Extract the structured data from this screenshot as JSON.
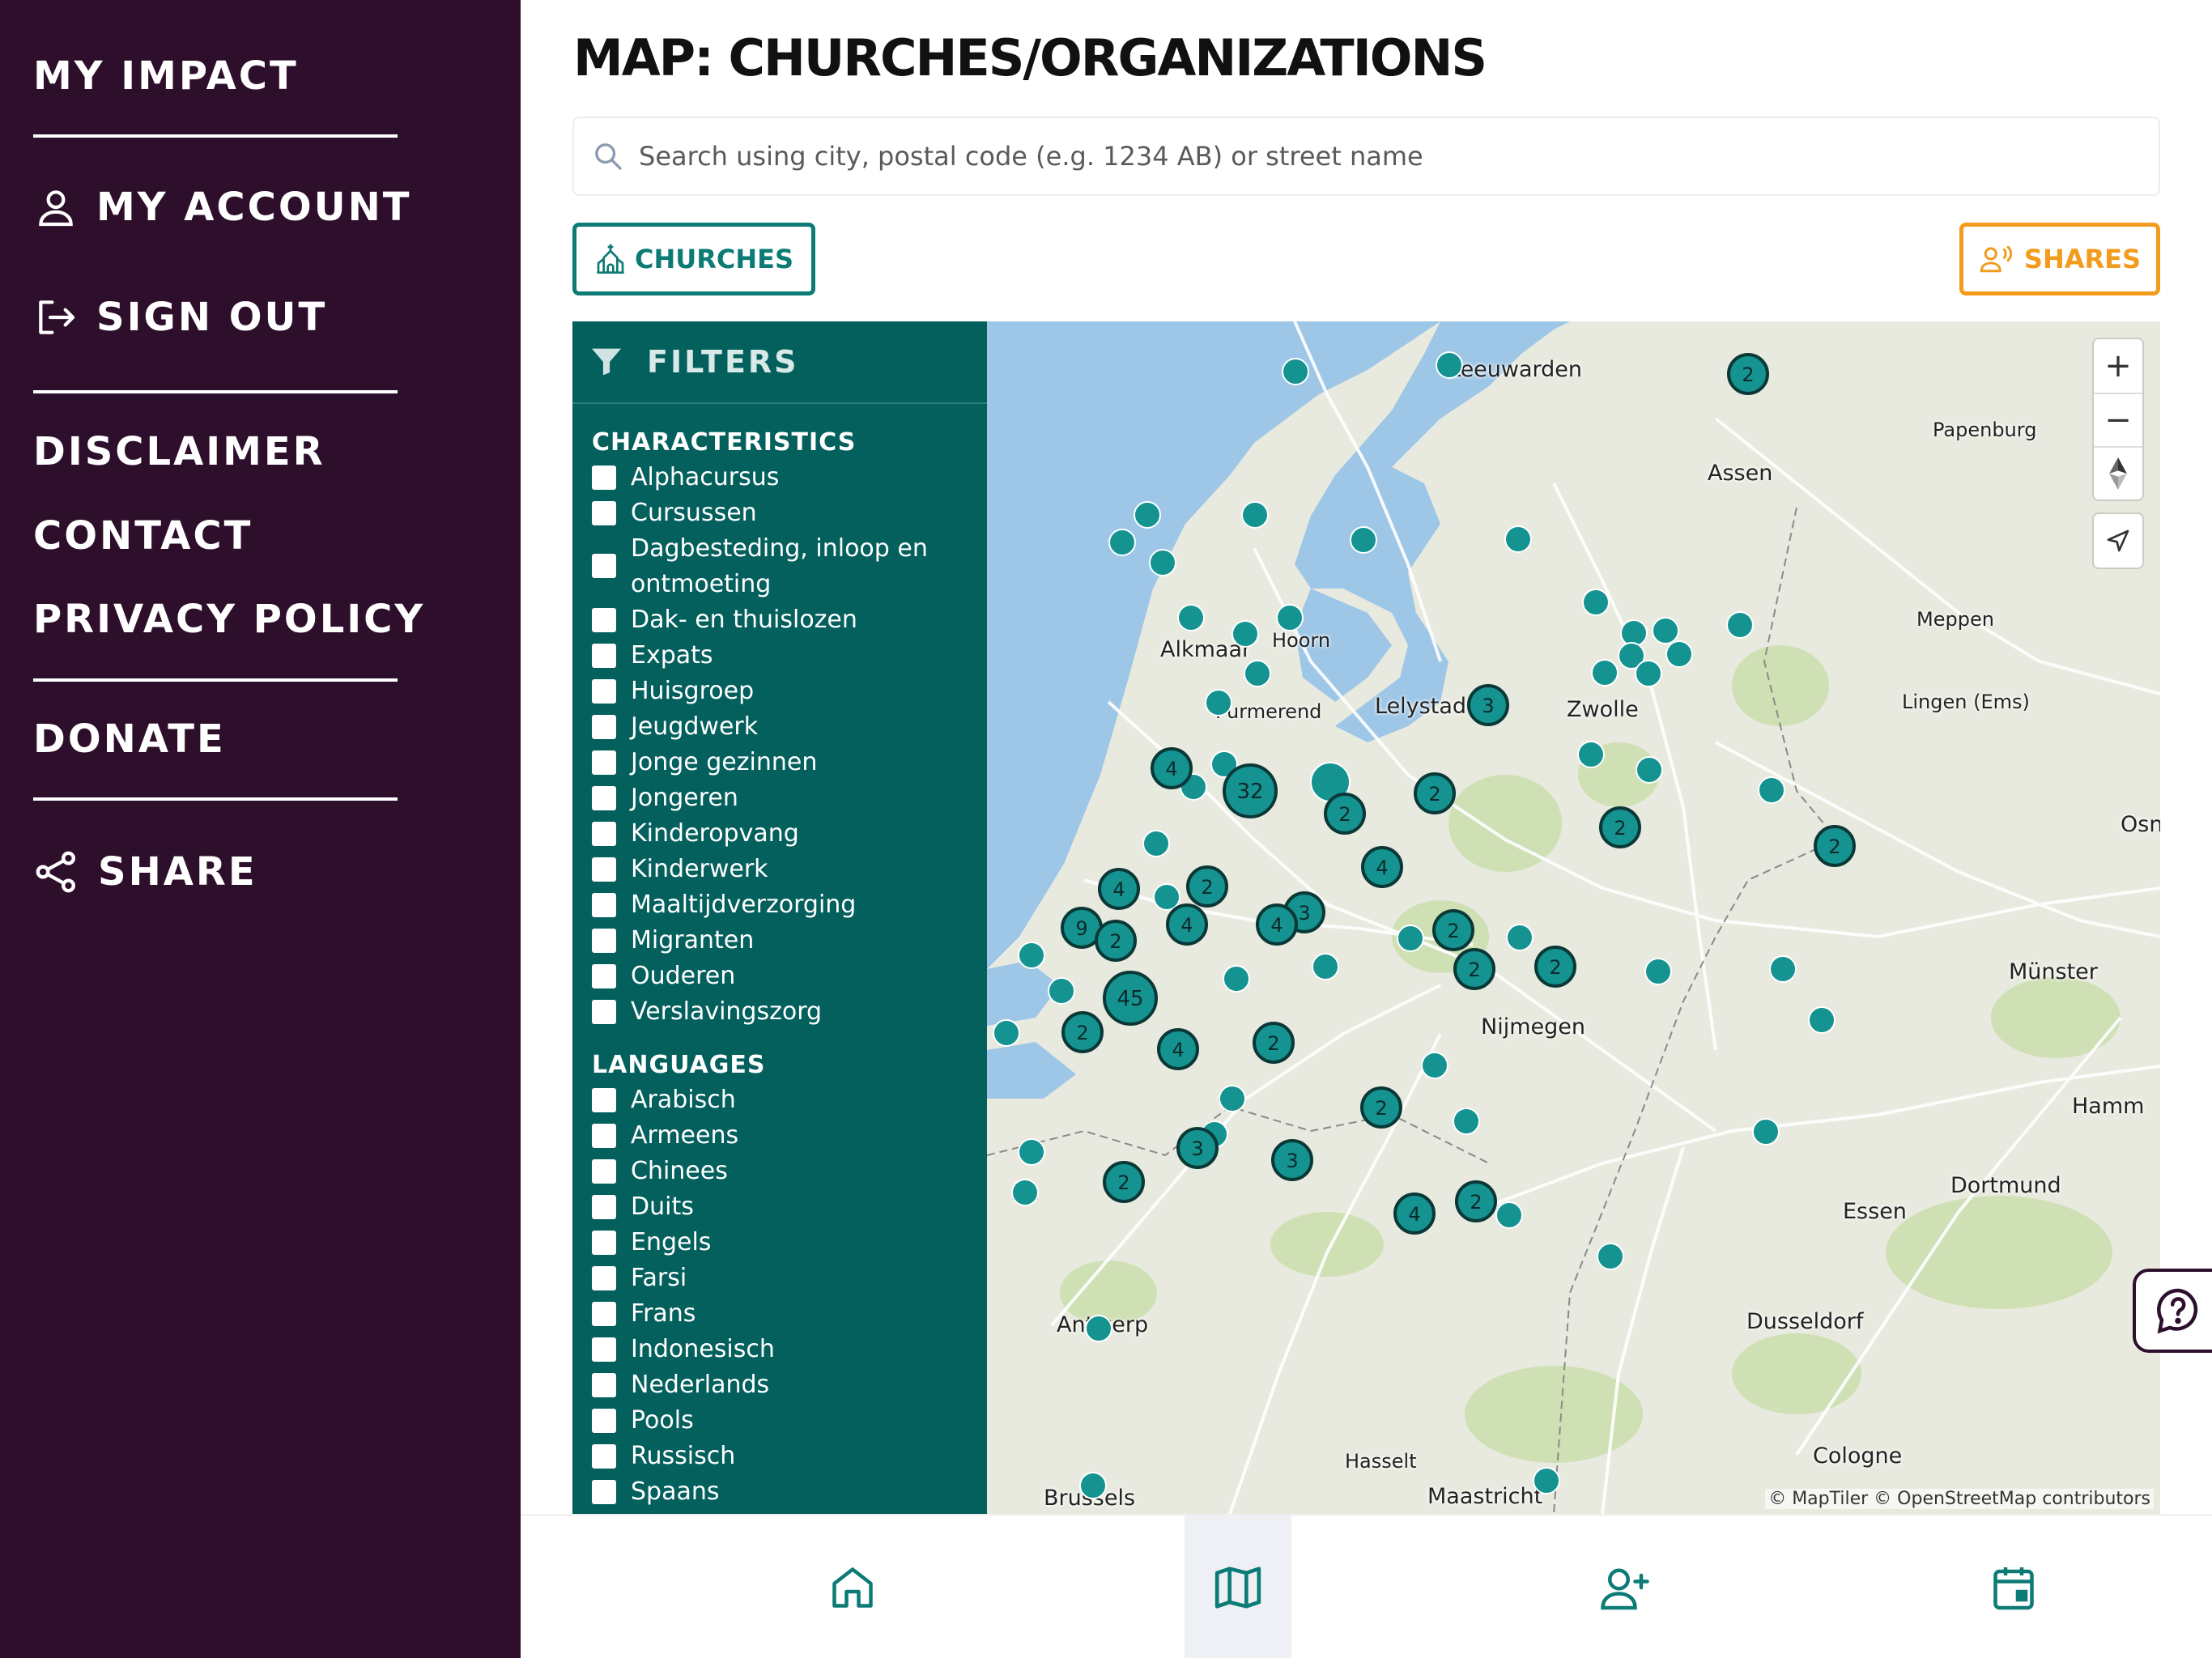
{
  "sidebar": {
    "my_impact": "MY IMPACT",
    "my_account": "MY ACCOUNT",
    "sign_out": "SIGN OUT",
    "disclaimer": "DISCLAIMER",
    "contact": "CONTACT",
    "privacy_policy": "PRIVACY POLICY",
    "donate": "DONATE",
    "share": "SHARE"
  },
  "header": {
    "title": "MAP: CHURCHES/ORGANIZATIONS"
  },
  "search": {
    "placeholder": "Search using city, postal code (e.g. 1234 AB) or street name",
    "value": ""
  },
  "buttons": {
    "churches": "CHURCHES",
    "shares": "SHARES"
  },
  "filters": {
    "title": "FILTERS",
    "characteristics_title": "CHARACTERISTICS",
    "characteristics": [
      "Alphacursus",
      "Cursussen",
      "Dagbesteding, inloop en ontmoeting",
      "Dak- en thuislozen",
      "Expats",
      "Huisgroep",
      "Jeugdwerk",
      "Jonge gezinnen",
      "Jongeren",
      "Kinderopvang",
      "Kinderwerk",
      "Maaltijdverzorging",
      "Migranten",
      "Ouderen",
      "Verslavingszorg"
    ],
    "languages_title": "LANGUAGES",
    "languages": [
      "Arabisch",
      "Armeens",
      "Chinees",
      "Duits",
      "Engels",
      "Farsi",
      "Frans",
      "Indonesisch",
      "Nederlands",
      "Pools",
      "Russisch",
      "Spaans"
    ]
  },
  "map": {
    "zoom_in": "+",
    "zoom_out": "−",
    "attribution": "© MapTiler © OpenStreetMap contributors",
    "cities": {
      "leeuwarden": "Leeuwarden",
      "papenburg": "Papenburg",
      "assen": "Assen",
      "meppen": "Meppen",
      "alkmaar": "Alkmaar",
      "hoorn": "Hoorn",
      "lelystad": "Lelystad",
      "zwolle": "Zwolle",
      "lingen": "Lingen (Ems)",
      "purmerend": "Purmerend",
      "osnabruck": "Osn",
      "munster": "Münster",
      "nijmegen": "Nijmegen",
      "hamm": "Hamm",
      "dortmund": "Dortmund",
      "essen": "Essen",
      "antwerp": "Antwerp",
      "dusseldorf": "Dusseldorf",
      "hasselt": "Hasselt",
      "cologne": "Cologne",
      "brussels": "Brussels",
      "maastricht": "Maastricht"
    },
    "clusters": [
      "2",
      "3",
      "4",
      "32",
      "2",
      "2",
      "2",
      "2",
      "4",
      "2",
      "3",
      "4",
      "2",
      "9",
      "4",
      "4",
      "2",
      "2",
      "2",
      "45",
      "2",
      "4",
      "2",
      "2",
      "3",
      "3",
      "2",
      "4",
      "2"
    ],
    "colors": {
      "marker": "#149391",
      "marker_border": "#0a3836",
      "water": "#9ec6e6",
      "land": "#e8eadf",
      "forest": "#cfe0b4"
    }
  },
  "bottom_nav": {
    "items": [
      "home",
      "map",
      "add-user",
      "calendar"
    ],
    "active": "map"
  }
}
